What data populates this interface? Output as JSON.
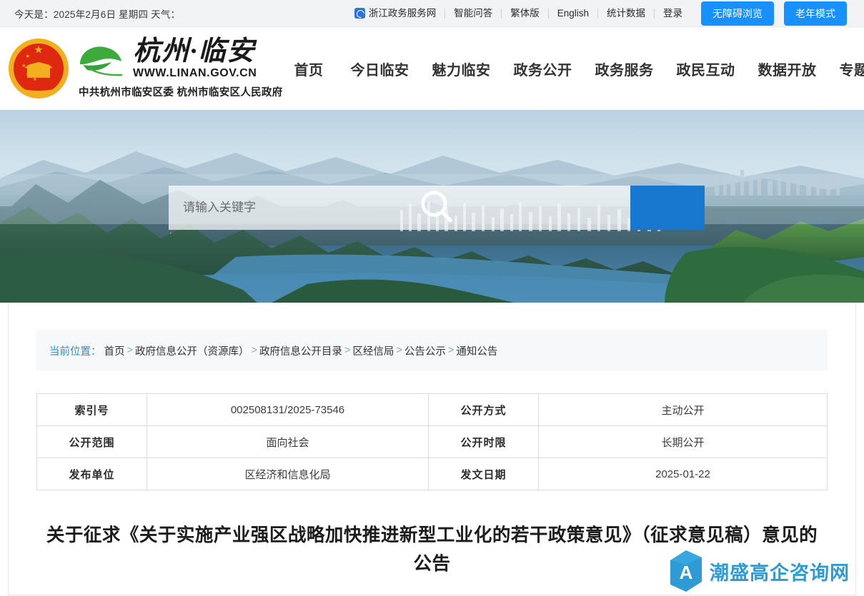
{
  "topbar": {
    "date_text": "今天是：2025年2月6日 星期四 天气：",
    "portal_name": "浙江政务服务网",
    "links": [
      "智能问答",
      "繁体版",
      "English",
      "统计数据",
      "登录"
    ],
    "buttons": [
      "无障碍浏览",
      "老年模式"
    ],
    "button_color": "#1890ff",
    "background": "#f2f3f5"
  },
  "header": {
    "city_name": "杭州·临安",
    "site_url": "WWW.LINAN.GOV.CN",
    "org_line": "中共杭州市临安区委  杭州市临安区人民政府",
    "emblem_name": "national-emblem",
    "nav": [
      "首页",
      "今日临安",
      "魅力临安",
      "政务公开",
      "政务服务",
      "政民互动",
      "数据开放",
      "专题专栏"
    ]
  },
  "banner": {
    "alt": "临安山水风景航拍",
    "search": {
      "placeholder": "请输入关键字",
      "value": "",
      "button_icon": "search-icon",
      "button_color": "#1878cf"
    }
  },
  "breadcrumb": {
    "label": "当前位置：",
    "items": [
      "首页",
      "政府信息公开（资源库）",
      "政府信息公开目录",
      "区经信局",
      "公告公示",
      "通知公告"
    ],
    "separator": ">",
    "background": "#f7f8fa",
    "label_color": "#2c8ec4"
  },
  "info_table": {
    "rows": [
      {
        "key_left": "索引号",
        "value_left": "002508131/2025-73546",
        "key_right": "公开方式",
        "value_right": "主动公开"
      },
      {
        "key_left": "公开范围",
        "value_left": "面向社会",
        "key_right": "公开时限",
        "value_right": "长期公开"
      },
      {
        "key_left": "发布单位",
        "value_left": "区经济和信息化局",
        "key_right": "发文日期",
        "value_right": "2025-01-22"
      }
    ]
  },
  "article": {
    "title": "关于征求《关于实施产业强区战略加快推进新型工业化的若干政策意见》（征求意见稿）意见的公告"
  },
  "watermark": {
    "text": "潮盛高企咨询网",
    "mark_letter": "A",
    "color": "#2e9bd4"
  }
}
